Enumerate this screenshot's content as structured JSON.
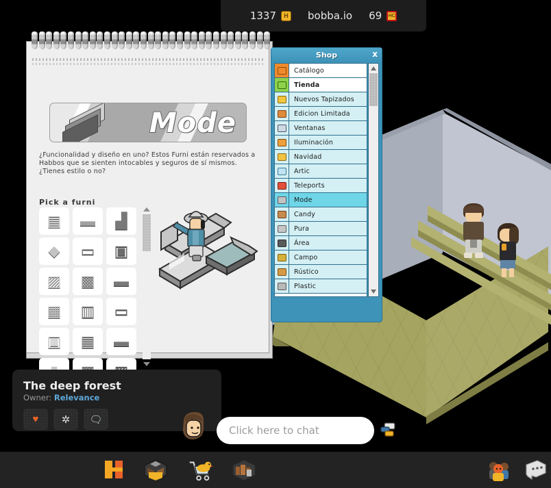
{
  "hud": {
    "credits": "1337",
    "credits_icon": "habbo-coin-icon",
    "site_name": "bobba.io",
    "duckets": "69",
    "duckets_icon": "hc-badge-icon"
  },
  "catalog": {
    "banner_title": "Mode",
    "banner_icon": "stacked-plates-furni-icon",
    "description": "¿Funcionalidad y diseño en uno? Estos Furni están reservados a Habbos que se sienten intocables y seguros de sí mismos. ¿Tienes estilo o no?",
    "pick_label": "Pick a furni",
    "furni_items": [
      {
        "name": "mode-shelf",
        "glyph": "▤"
      },
      {
        "name": "mode-pillow",
        "glyph": "▬"
      },
      {
        "name": "mode-chair",
        "glyph": "▟"
      },
      {
        "name": "mode-stacked-plates",
        "glyph": "◆"
      },
      {
        "name": "mode-bed",
        "glyph": "▭"
      },
      {
        "name": "mode-armchair",
        "glyph": "▣"
      },
      {
        "name": "mode-sofa",
        "glyph": "▨"
      },
      {
        "name": "mode-bench",
        "glyph": "▩"
      },
      {
        "name": "mode-long-seat",
        "glyph": "▬"
      },
      {
        "name": "mode-fridge",
        "glyph": "▦"
      },
      {
        "name": "mode-fireplace",
        "glyph": "▥"
      },
      {
        "name": "mode-divider",
        "glyph": "▭"
      },
      {
        "name": "mode-stove",
        "glyph": "▣"
      },
      {
        "name": "mode-table",
        "glyph": "▤"
      },
      {
        "name": "mode-counter",
        "glyph": "▬"
      },
      {
        "name": "mode-lamp",
        "glyph": "▮"
      },
      {
        "name": "mode-dark-sofa",
        "glyph": "▩"
      },
      {
        "name": "mode-light-sofa",
        "glyph": "▨"
      }
    ],
    "scroll_up_icon": "triangle-up-icon",
    "scroll_down_icon": "triangle-down-icon"
  },
  "shop": {
    "title": "Shop",
    "close_label": "x",
    "scroll_up_icon": "triangle-up-icon",
    "scroll_down_icon": "triangle-down-icon",
    "items": [
      {
        "label": "Catálogo",
        "icon": "basket-icon",
        "style": "white",
        "bold": false
      },
      {
        "label": "Tienda",
        "icon": "green-chair-icon",
        "style": "white",
        "bold": true
      },
      {
        "label": "Nuevos Tapizados",
        "icon": "yellow-sofa-icon",
        "style": "normal",
        "bold": false
      },
      {
        "label": "Edicion Limitada",
        "icon": "orange-box-icon",
        "style": "normal",
        "bold": false
      },
      {
        "label": "Ventanas",
        "icon": "window-icon",
        "style": "normal",
        "bold": false
      },
      {
        "label": "Iluminación",
        "icon": "lamp-icon",
        "style": "normal",
        "bold": false
      },
      {
        "label": "Navidad",
        "icon": "star-icon",
        "style": "normal",
        "bold": false
      },
      {
        "label": "Artic",
        "icon": "snow-icon",
        "style": "normal",
        "bold": false
      },
      {
        "label": "Teleports",
        "icon": "teleport-icon",
        "style": "normal",
        "bold": false
      },
      {
        "label": "Mode",
        "icon": "grey-plates-icon",
        "style": "active",
        "bold": false
      },
      {
        "label": "Candy",
        "icon": "candy-icon",
        "style": "normal",
        "bold": false
      },
      {
        "label": "Pura",
        "icon": "pura-icon",
        "style": "normal",
        "bold": false
      },
      {
        "label": "Área",
        "icon": "area-chair-icon",
        "style": "normal",
        "bold": false
      },
      {
        "label": "Campo",
        "icon": "wheat-icon",
        "style": "normal",
        "bold": false
      },
      {
        "label": "Rústico",
        "icon": "wood-bench-icon",
        "style": "normal",
        "bold": false
      },
      {
        "label": "Plastic",
        "icon": "plastic-icon",
        "style": "normal",
        "bold": false
      }
    ]
  },
  "room": {
    "title": "The deep forest",
    "owner_prefix": "Owner: ",
    "owner_name": "Relevance",
    "buttons": [
      {
        "name": "favorite-button",
        "icon": "heart-icon",
        "glyph": "♥",
        "color": "#e8642a"
      },
      {
        "name": "settings-button",
        "icon": "gear-icon",
        "glyph": "✲",
        "color": "#dcdcdc"
      },
      {
        "name": "chatlog-button",
        "icon": "chat-log-icon",
        "glyph": "🗨",
        "color": "#cfd8df"
      }
    ]
  },
  "chat": {
    "placeholder": "Click here to chat",
    "value": "",
    "avatar_icon": "user-head-icon",
    "style_button_icon": "chat-style-icon"
  },
  "toolbar": {
    "left_buttons": [
      {
        "name": "habbo-home-button",
        "icon": "habbo-logo-icon"
      },
      {
        "name": "inventory-button",
        "icon": "inventory-box-icon"
      },
      {
        "name": "catalog-button",
        "icon": "shopping-cart-icon"
      },
      {
        "name": "room-builder-button",
        "icon": "room-furni-icon"
      }
    ],
    "right_buttons": [
      {
        "name": "friends-button",
        "icon": "friends-group-icon"
      },
      {
        "name": "messenger-button",
        "icon": "speech-bubble-icon"
      }
    ]
  },
  "colors": {
    "shop_accent": "#3e93b8",
    "shop_active_row": "#6fd6e8",
    "shop_row": "#d4f0f4",
    "owner_link": "#5fa8d8",
    "floor": "#a5a460",
    "wall_left": "#a9aebb",
    "wall_right": "#c0c5d1",
    "panel_dark": "#202020",
    "toolbar": "#232323",
    "credit_gold": "#f0b429"
  }
}
